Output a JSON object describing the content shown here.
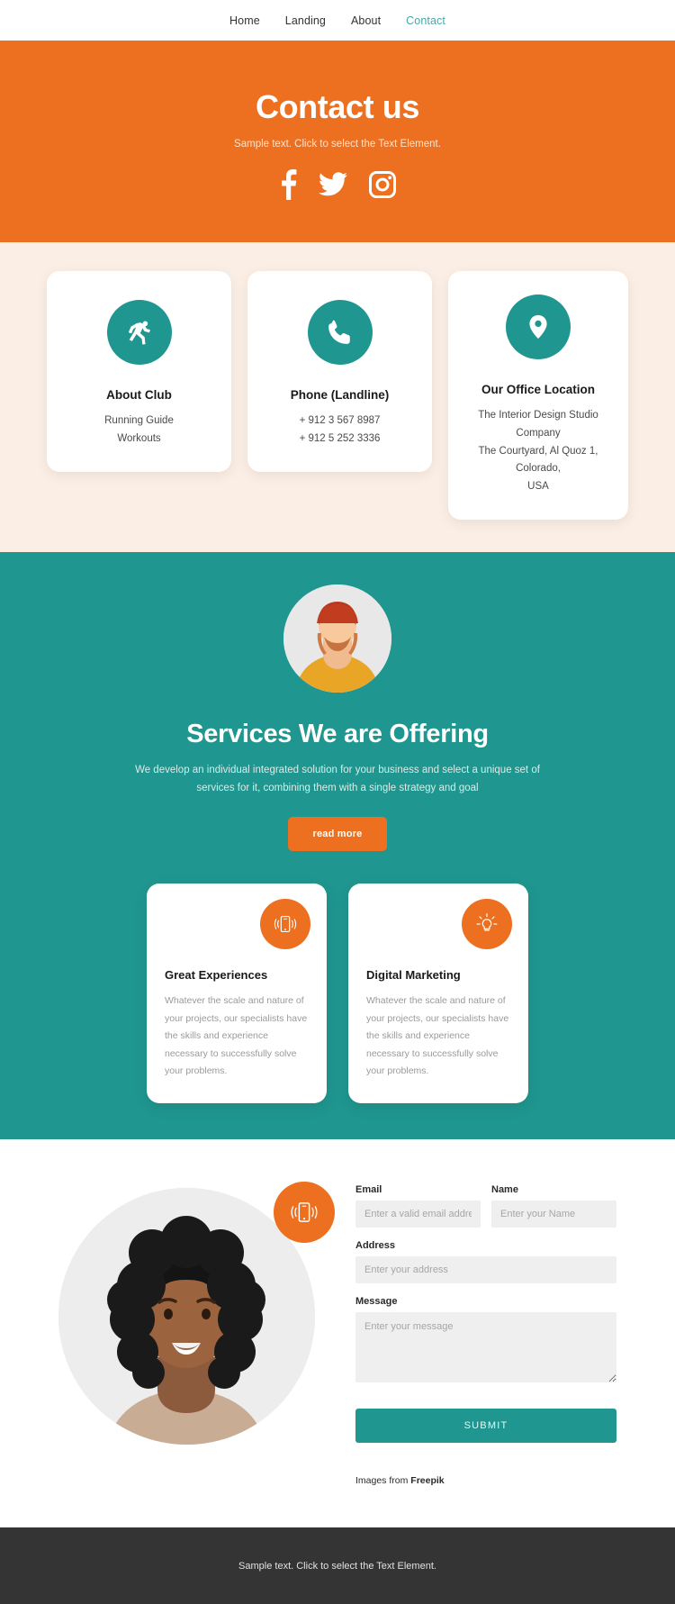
{
  "nav": {
    "items": [
      {
        "label": "Home",
        "active": false
      },
      {
        "label": "Landing",
        "active": false
      },
      {
        "label": "About",
        "active": false
      },
      {
        "label": "Contact",
        "active": true
      }
    ]
  },
  "hero": {
    "title": "Contact us",
    "subtitle": "Sample text. Click to select the Text Element.",
    "socials": [
      "facebook-icon",
      "twitter-icon",
      "instagram-icon"
    ]
  },
  "info_cards": [
    {
      "icon": "running-icon",
      "title": "About Club",
      "lines": [
        "Running Guide",
        "Workouts"
      ]
    },
    {
      "icon": "phone-icon",
      "title": "Phone (Landline)",
      "lines": [
        "+ 912 3 567 8987",
        "+ 912 5 252 3336"
      ]
    },
    {
      "icon": "location-pin-icon",
      "title": "Our Office Location",
      "lines": [
        "The Interior Design Studio Company",
        "The Courtyard, Al Quoz 1, Colorado,",
        "USA"
      ]
    }
  ],
  "services": {
    "avatar": "man-portrait-avatar",
    "title": "Services We are Offering",
    "subtitle": "We develop an individual integrated solution for your business and select a unique set of services for it, combining them with a single strategy and goal",
    "button_label": "read more",
    "cards": [
      {
        "icon": "phone-vibrate-icon",
        "title": "Great Experiences",
        "text": "Whatever the scale and nature of your projects, our specialists have the skills and experience necessary to successfully solve your problems."
      },
      {
        "icon": "lightbulb-icon",
        "title": "Digital Marketing",
        "text": "Whatever the scale and nature of your projects, our specialists have the skills and experience necessary to successfully solve your problems."
      }
    ]
  },
  "contact": {
    "photo": "woman-portrait-photo",
    "photo_badge_icon": "phone-vibrate-icon",
    "fields": {
      "email": {
        "label": "Email",
        "placeholder": "Enter a valid email address",
        "value": ""
      },
      "name": {
        "label": "Name",
        "placeholder": "Enter your Name",
        "value": ""
      },
      "address": {
        "label": "Address",
        "placeholder": "Enter your address",
        "value": ""
      },
      "message": {
        "label": "Message",
        "placeholder": "Enter your message",
        "value": ""
      }
    },
    "submit_label": "SUBMIT",
    "credit_prefix": "Images from ",
    "credit_source": "Freepik"
  },
  "footer": {
    "text": "Sample text. Click to select the Text Element."
  },
  "colors": {
    "orange": "#ed7020",
    "teal": "#1f968f",
    "cream": "#fbeee4",
    "footer_dark": "#343434",
    "input_gray": "#efefef"
  }
}
